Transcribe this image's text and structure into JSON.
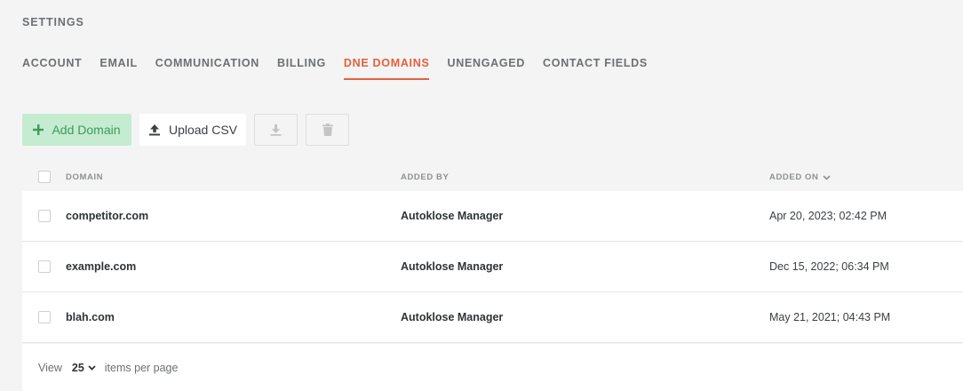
{
  "header": {
    "title": "SETTINGS"
  },
  "tabs": [
    {
      "label": "ACCOUNT"
    },
    {
      "label": "EMAIL"
    },
    {
      "label": "COMMUNICATION"
    },
    {
      "label": "BILLING"
    },
    {
      "label": "DNE DOMAINS",
      "active": true
    },
    {
      "label": "UNENGAGED"
    },
    {
      "label": "CONTACT FIELDS"
    }
  ],
  "toolbar": {
    "add_label": "Add Domain",
    "upload_label": "Upload CSV"
  },
  "table": {
    "columns": {
      "domain": "DOMAIN",
      "added_by": "ADDED BY",
      "added_on": "ADDED ON"
    },
    "rows": [
      {
        "domain": "competitor.com",
        "added_by": "Autoklose Manager",
        "added_on": "Apr 20, 2023; 02:42 PM"
      },
      {
        "domain": "example.com",
        "added_by": "Autoklose Manager",
        "added_on": "Dec 15, 2022; 06:34 PM"
      },
      {
        "domain": "blah.com",
        "added_by": "Autoklose Manager",
        "added_on": "May 21, 2021; 04:43 PM"
      }
    ]
  },
  "pagination": {
    "view_label": "View",
    "per_page_value": "25",
    "per_page_label": "items per page"
  },
  "colors": {
    "accent": "#e5603d",
    "add_bg": "#c5ecd0",
    "add_text": "#3a9a5c"
  }
}
